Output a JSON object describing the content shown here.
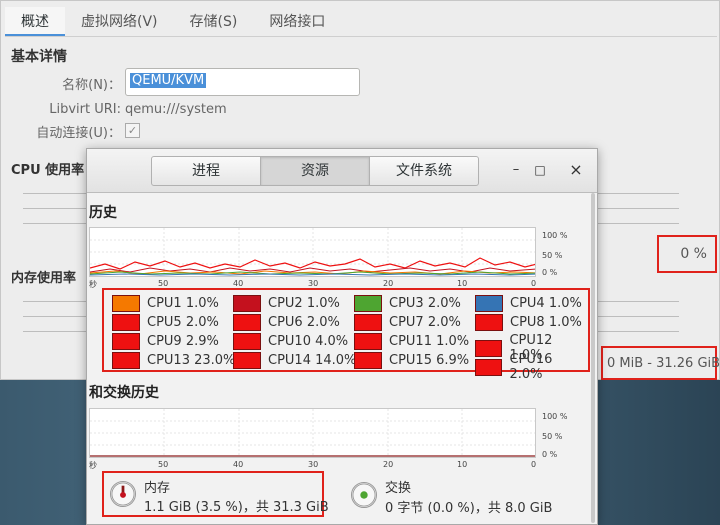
{
  "back_window": {
    "tabs": [
      "概述",
      "虚拟网络(V)",
      "存储(S)",
      "网络接口"
    ],
    "basic_details_title": "基本详情",
    "name_label": "名称(N)：",
    "name_value": "QEMU/KVM",
    "libvirt_label": "Libvirt URI:",
    "libvirt_value": "qemu:///system",
    "autoconnect_label": "自动连接(U)：",
    "autoconnect_checked": true,
    "cpu_usage_title": "CPU 使用率",
    "mem_usage_title": "内存使用率",
    "cpu_percent": "0 %",
    "mem_value": "0 MiB - 31.26 GiB"
  },
  "front_window": {
    "tabs": [
      "进程",
      "资源",
      "文件系统"
    ],
    "active_tab": "资源",
    "window_controls": {
      "minimize": "–",
      "maximize": "□",
      "close": "×"
    },
    "cpu_history_title": "历史",
    "cpu_graph": {
      "y_ticks": [
        "100 %",
        "50 %",
        "0 %"
      ],
      "x_ticks": [
        "秒",
        "50",
        "40",
        "30",
        "20",
        "10",
        "0"
      ]
    },
    "cpus": [
      {
        "label": "CPU1 1.0%",
        "color": "#f57900",
        "usage": 1.0
      },
      {
        "label": "CPU2 1.0%",
        "color": "#c4111e",
        "usage": 1.0
      },
      {
        "label": "CPU3 2.0%",
        "color": "#4ea531",
        "usage": 2.0
      },
      {
        "label": "CPU4 1.0%",
        "color": "#3574b4",
        "usage": 1.0
      },
      {
        "label": "CPU5 2.0%",
        "color": "#ee1111",
        "usage": 2.0
      },
      {
        "label": "CPU6 2.0%",
        "color": "#ee1111",
        "usage": 2.0
      },
      {
        "label": "CPU7 2.0%",
        "color": "#ee1111",
        "usage": 2.0
      },
      {
        "label": "CPU8 1.0%",
        "color": "#ee1111",
        "usage": 1.0
      },
      {
        "label": "CPU9 2.9%",
        "color": "#ee1111",
        "usage": 2.9
      },
      {
        "label": "CPU10 4.0%",
        "color": "#ee1111",
        "usage": 4.0
      },
      {
        "label": "CPU11 1.0%",
        "color": "#ee1111",
        "usage": 1.0
      },
      {
        "label": "CPU12 1.0%",
        "color": "#ee1111",
        "usage": 1.0
      },
      {
        "label": "CPU13 23.0%",
        "color": "#ee1111",
        "usage": 23.0
      },
      {
        "label": "CPU14 14.0%",
        "color": "#ee1111",
        "usage": 14.0
      },
      {
        "label": "CPU15 6.9%",
        "color": "#ee1111",
        "usage": 6.9
      },
      {
        "label": "CPU16 2.0%",
        "color": "#ee1111",
        "usage": 2.0
      }
    ],
    "mem_history_title": "和交换历史",
    "mem_graph": {
      "y_ticks": [
        "100 %",
        "50 %",
        "0 %"
      ],
      "x_ticks": [
        "秒",
        "50",
        "40",
        "30",
        "20",
        "10",
        "0"
      ]
    },
    "memory": {
      "title": "内存",
      "detail": "1.1 GiB (3.5 %)，共 31.3 GiB",
      "percent": 3.5
    },
    "swap": {
      "title": "交换",
      "detail": "0 字节 (0.0 %)，共 8.0 GiB",
      "percent": 0.0
    }
  }
}
